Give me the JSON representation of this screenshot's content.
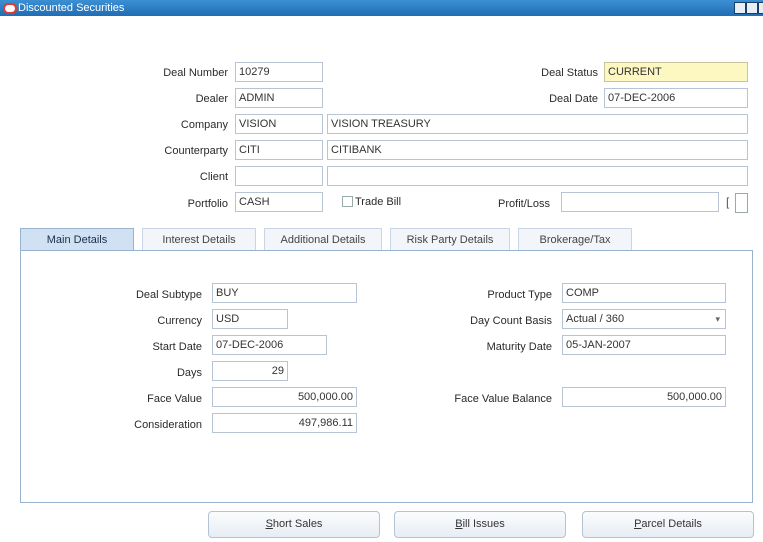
{
  "window": {
    "title": "Discounted Securities"
  },
  "header": {
    "deal_number": {
      "label": "Deal Number",
      "value": "10279"
    },
    "deal_status": {
      "label": "Deal Status",
      "value": "CURRENT"
    },
    "dealer": {
      "label": "Dealer",
      "value": "ADMIN"
    },
    "deal_date": {
      "label": "Deal Date",
      "value": "07-DEC-2006"
    },
    "company": {
      "label": "Company",
      "code": "VISION",
      "name": "VISION TREASURY"
    },
    "counterparty": {
      "label": "Counterparty",
      "code": "CITI",
      "name": "CITIBANK"
    },
    "client": {
      "label": "Client",
      "code": "",
      "name": ""
    },
    "portfolio": {
      "label": "Portfolio",
      "value": "CASH"
    },
    "trade_bill": {
      "label": "Trade Bill"
    },
    "profit_loss": {
      "label": "Profit/Loss",
      "value": ""
    }
  },
  "tabs": [
    {
      "label": "Main Details",
      "active": true
    },
    {
      "label": "Interest Details"
    },
    {
      "label": "Additional Details"
    },
    {
      "label": "Risk Party Details"
    },
    {
      "label": "Brokerage/Tax"
    }
  ],
  "main": {
    "deal_subtype": {
      "label": "Deal Subtype",
      "value": "BUY"
    },
    "product_type": {
      "label": "Product Type",
      "value": "COMP"
    },
    "currency": {
      "label": "Currency",
      "value": "USD"
    },
    "day_count_basis": {
      "label": "Day Count Basis",
      "value": "Actual / 360"
    },
    "start_date": {
      "label": "Start Date",
      "value": "07-DEC-2006"
    },
    "maturity_date": {
      "label": "Maturity Date",
      "value": "05-JAN-2007"
    },
    "days": {
      "label": "Days",
      "value": "29"
    },
    "face_value": {
      "label": "Face Value",
      "value": "500,000.00"
    },
    "face_value_balance": {
      "label": "Face Value Balance",
      "value": "500,000.00"
    },
    "consideration": {
      "label": "Consideration",
      "value": "497,986.11"
    }
  },
  "buttons": {
    "short_sales": {
      "accel": "S",
      "rest": "hort Sales"
    },
    "bill_issues": {
      "accel": "B",
      "rest": "ill Issues"
    },
    "parcel_details": {
      "accel": "P",
      "rest": "arcel Details"
    }
  }
}
